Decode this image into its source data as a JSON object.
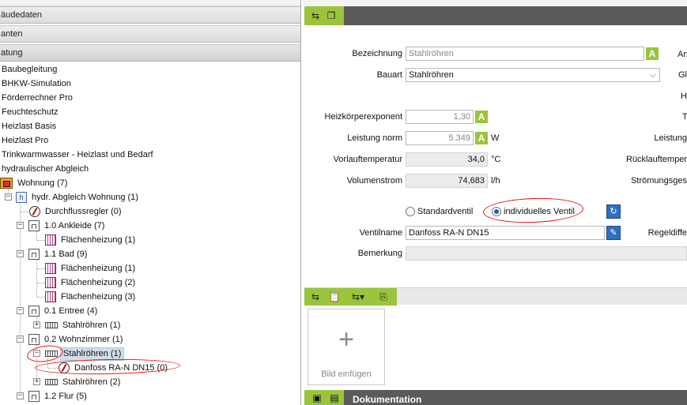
{
  "left": {
    "headers": [
      "äudedaten",
      "anten",
      "atung"
    ],
    "modules": [
      "Baubegleitung",
      "BHKW-Simulation",
      "Förderrechner Pro",
      "Feuchteschutz",
      "Heizlast Basis",
      "Heizlast Pro",
      "Trinkwarmwasser - Heizlast und Bedarf",
      "hydraulischer Abgleich"
    ],
    "tree": {
      "root": "Wohnung (7)",
      "calc": "hydr. Abgleich Wohnung (1)",
      "regler": "Durchflussregler (0)",
      "r1": "1.0 Ankleide (7)",
      "r1_fh1": "Flächenheizung (1)",
      "r2": "1.1 Bad (9)",
      "r2_fh1": "Flächenheizung (1)",
      "r2_fh2": "Flächenheizung (2)",
      "r2_fh3": "Flächenheizung (3)",
      "r3": "0.1 Entree (4)",
      "r3_p1": "Stahlröhren (1)",
      "r4": "0.2 Wohnzimmer (1)",
      "r4_p1": "Stahlröhren (1)",
      "r4_p1_valve": "Danfoss RA-N DN15 (0)",
      "r4_p2": "Stahlröhren (2)",
      "r5": "1.2 Flur (5)"
    }
  },
  "right": {
    "bezeichnung_label": "Bezeichnung",
    "bezeichnung_value": "Stahlröhren",
    "bauart_label": "Bauart",
    "bauart_value": "Stahlröhren",
    "exp_label": "Heizkörperexponent",
    "exp_value": "1,30",
    "leistung_label": "Leistung norm",
    "leistung_value": "5.349",
    "leistung_unit": "W",
    "vorlauf_label": "Vorlauftemperatur",
    "vorlauf_value": "34,0",
    "vorlauf_unit": "°C",
    "volumen_label": "Volumenstrom",
    "volumen_value": "74,683",
    "volumen_unit": "l/h",
    "radio_standard": "Standardventil",
    "radio_individual": "individuelles Ventil",
    "ventilname_label": "Ventilname",
    "ventilname_value": "Danfoss RA-N DN15",
    "bemerkung_label": "Bemerkung",
    "badge": "A",
    "cut_labels": {
      "an": "An",
      "gl": "Gl",
      "h": "H",
      "t": "T",
      "leistung": "Leistung",
      "ruecklauf": "Rücklauftemper",
      "stroemung": "Strömungsges",
      "regeldiff": "Regeldiffe"
    },
    "image_caption": "Bild einfügen",
    "doc_title": "Dokumentation"
  },
  "colors": {
    "accent_green": "#9bc43c",
    "dark_bar": "#5a5a5a",
    "annotation_red": "#e11111",
    "selection": "#d3dde9"
  }
}
